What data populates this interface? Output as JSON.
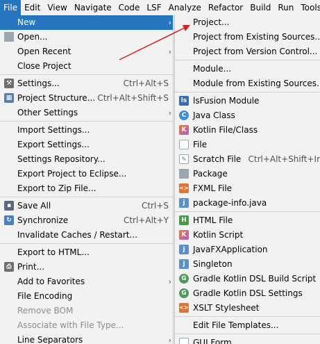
{
  "menubar": [
    "File",
    "Edit",
    "View",
    "Navigate",
    "Code",
    "LSF",
    "Analyze",
    "Refactor",
    "Build",
    "Run",
    "Tools"
  ],
  "file_menu": {
    "new": "New",
    "open": "Open...",
    "open_recent": "Open Recent",
    "close_project": "Close Project",
    "settings": "Settings...",
    "settings_sc": "Ctrl+Alt+S",
    "project_structure": "Project Structure...",
    "project_structure_sc": "Ctrl+Alt+Shift+S",
    "other_settings": "Other Settings",
    "import_settings": "Import Settings...",
    "export_settings": "Export Settings...",
    "settings_repository": "Settings Repository...",
    "export_eclipse": "Export Project to Eclipse...",
    "export_zip": "Export to Zip File...",
    "save_all": "Save All",
    "save_all_sc": "Ctrl+S",
    "synchronize": "Synchronize",
    "synchronize_sc": "Ctrl+Alt+Y",
    "invalidate_caches": "Invalidate Caches / Restart...",
    "export_html": "Export to HTML...",
    "print": "Print...",
    "add_favorites": "Add to Favorites",
    "file_encoding": "File Encoding",
    "remove_bom": "Remove BOM",
    "associate_file_type": "Associate with File Type...",
    "line_separators": "Line Separators"
  },
  "new_submenu": {
    "project": "Project...",
    "project_existing": "Project from Existing Sources...",
    "project_vcs": "Project from Version Control...",
    "module": "Module...",
    "module_existing": "Module from Existing Sources...",
    "lsfusion_module": "lsFusion Module",
    "java_class": "Java Class",
    "kotlin_file_class": "Kotlin File/Class",
    "file": "File",
    "scratch_file": "Scratch File",
    "scratch_file_sc": "Ctrl+Alt+Shift+Ir",
    "package": "Package",
    "fxml_file": "FXML File",
    "package_info": "package-info.java",
    "html_file": "HTML File",
    "kotlin_script": "Kotlin Script",
    "javafx_app": "JavaFXApplication",
    "singleton": "Singleton",
    "gradle_build_script": "Gradle Kotlin DSL Build Script",
    "gradle_settings": "Gradle Kotlin DSL Settings",
    "xslt_stylesheet": "XSLT Stylesheet",
    "edit_file_templates": "Edit File Templates...",
    "gui_form": "GUI Form"
  },
  "colors": {
    "selection": "#2675bf",
    "annotation_arrow": "#d42020"
  }
}
